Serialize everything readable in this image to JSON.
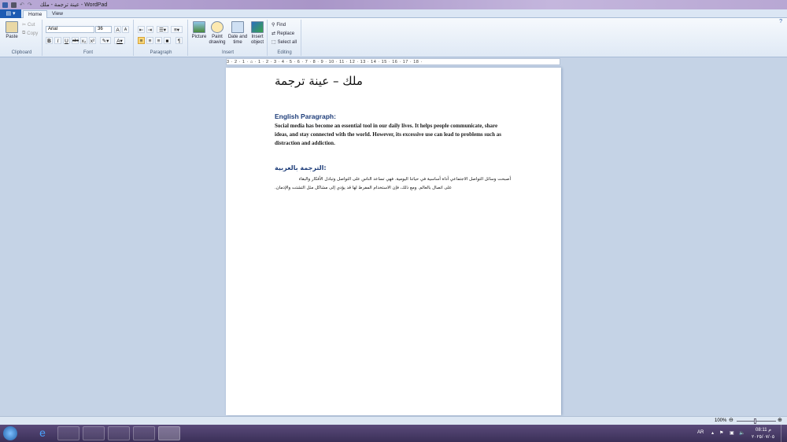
{
  "window": {
    "title": "عينة ترجمة - ملك - WordPad"
  },
  "tabs": [
    "Home",
    "View"
  ],
  "ribbon": {
    "clipboard": {
      "label": "Clipboard",
      "paste": "Paste",
      "cut": "Cut",
      "copy": "Copy"
    },
    "font": {
      "label": "Font",
      "family": "Arial",
      "size": "36",
      "bold": "B",
      "italic": "I",
      "underline": "U",
      "strike": "abc",
      "sub": "x₂",
      "sup": "x²"
    },
    "paragraph": {
      "label": "Paragraph"
    },
    "insert": {
      "label": "Insert",
      "picture": "Picture",
      "paint": "Paint drawing",
      "datetime": "Date and time",
      "object": "Insert object"
    },
    "editing": {
      "label": "Editing",
      "find": "Find",
      "replace": "Replace",
      "select_all": "Select all"
    }
  },
  "ruler": "3 · 2 · 1 · ⌂ · 1 · 2 · 3 · 4 · 5 · 6 · 7 · 8 · 9 · 10 · 11 · 12 · 13 · 14 · 15 · 16 · 17 · 18 ·",
  "document": {
    "title": "ملك – عينة ترجمة",
    "english_heading": "English Paragraph:",
    "english_text": "Social media has become an essential tool in our daily lives. It helps people communicate, share ideas, and stay connected with the world. However, its excessive use can lead to problems such as distraction and addiction.",
    "arabic_heading": "الترجمة بالعربية:",
    "arabic_line1": "أصبحت وسائل التواصل الاجتماعي أداة أساسية في حياتنا اليومية. فهي تساعد الناس على التواصل وتبادل الأفكار والبقاء",
    "arabic_line2": "على اتصال بالعالم. ومع ذلك، فإن الاستخدام المفرط لها قد يؤدي إلى مشاكل مثل التشتت والإدمان."
  },
  "status": {
    "zoom": "100%"
  },
  "tray": {
    "lang": "AR",
    "time": "08:11 م",
    "date": "٢٠٢٥/٠٧/٠٥"
  }
}
